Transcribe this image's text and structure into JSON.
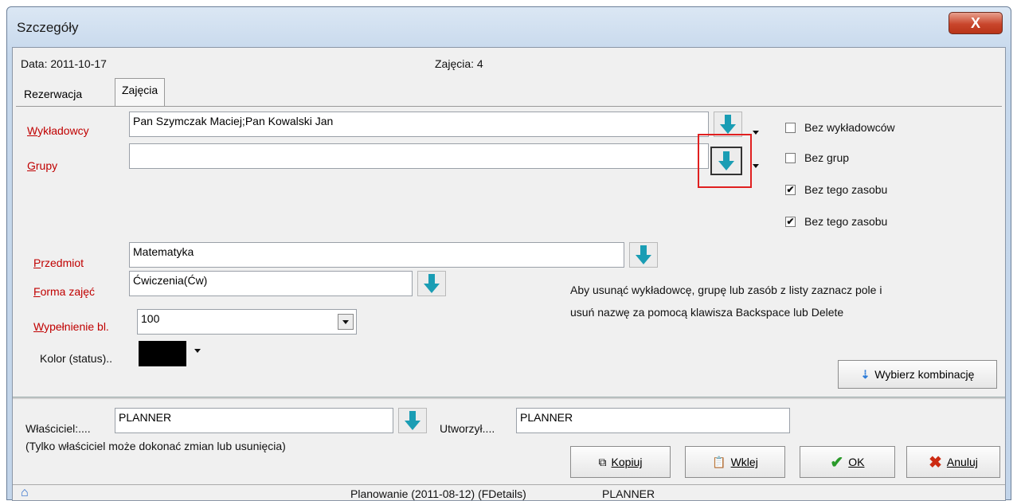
{
  "window": {
    "title": "Szczegóły",
    "close_label": "X"
  },
  "header": {
    "date": "Data:  2011-10-17",
    "lessons": "Zajęcia: 4"
  },
  "tabs": [
    {
      "label": "Rezerwacja"
    },
    {
      "label": "Zajęcia"
    }
  ],
  "form": {
    "lecturers": {
      "label_first": "W",
      "label_rest": "ykładowcy",
      "value": "Pan Szymczak Maciej;Pan Kowalski Jan"
    },
    "groups": {
      "label_first": "G",
      "label_rest": "rupy",
      "value": ""
    },
    "subject": {
      "label_first": "P",
      "label_rest": "rzedmiot",
      "value": "Matematyka"
    },
    "form_type": {
      "label_first": "F",
      "label_rest": "orma zajęć",
      "value": "Ćwiczenia(Ćw)"
    },
    "fill": {
      "label_first": "W",
      "label_rest": "ypełnienie bl.",
      "value": "100"
    },
    "color": {
      "label": "Kolor (status)..",
      "swatch": "#000000"
    }
  },
  "checkboxes": [
    {
      "label": "Bez wykładowców",
      "checked": ""
    },
    {
      "label": "Bez grup",
      "checked": ""
    },
    {
      "label": "Bez tego zasobu",
      "checked": "✔"
    },
    {
      "label": "Bez tego zasobu",
      "checked": "✔"
    }
  ],
  "hint": {
    "line1": "Aby usunąć wykładowcę, grupę lub zasób z listy zaznacz pole i",
    "line2": "usuń nazwę za pomocą klawisza Backspace lub Delete"
  },
  "combo_button": "Wybierz kombinację",
  "owner": {
    "label": "Właściciel:....",
    "value": "PLANNER",
    "created_label": "Utworzył....",
    "created_value": "PLANNER",
    "note": "(Tylko właściciel może dokonać zmian lub usunięcia)"
  },
  "buttons": {
    "copy": "Kopiuj",
    "paste": "Wklej",
    "ok": "OK",
    "cancel": "Anuluj"
  },
  "status_bar": {
    "text": "Planowanie (2011-08-12) (FDetails)",
    "user": "PLANNER"
  },
  "colors": {
    "label_red": "#c00000",
    "arrow": "#1a9db4",
    "highlight": "#e02020"
  }
}
